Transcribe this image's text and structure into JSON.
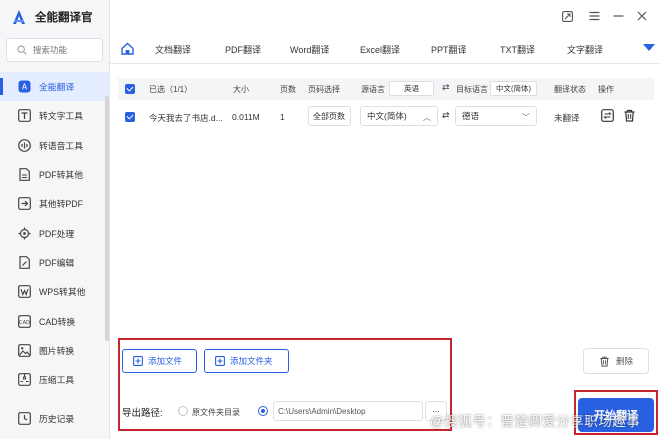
{
  "app": {
    "title": "全能翻译官"
  },
  "search": {
    "placeholder": "搜索功能"
  },
  "sidebar": {
    "items": [
      {
        "label": "全能翻译",
        "icon": "translate-icon",
        "active": true
      },
      {
        "label": "转文字工具",
        "icon": "text-convert-icon"
      },
      {
        "label": "转语音工具",
        "icon": "voice-icon"
      },
      {
        "label": "PDF转其他",
        "icon": "pdf-convert-icon"
      },
      {
        "label": "其他转PDF",
        "icon": "to-pdf-icon"
      },
      {
        "label": "PDF处理",
        "icon": "pdf-process-icon"
      },
      {
        "label": "PDF编辑",
        "icon": "pdf-edit-icon"
      },
      {
        "label": "WPS转其他",
        "icon": "wps-convert-icon"
      },
      {
        "label": "CAD转换",
        "icon": "cad-icon"
      },
      {
        "label": "图片转换",
        "icon": "image-convert-icon"
      },
      {
        "label": "压缩工具",
        "icon": "compress-icon"
      }
    ],
    "history": "历史记录"
  },
  "tabs": [
    {
      "label": "文档翻译",
      "active": true
    },
    {
      "label": "PDF翻译"
    },
    {
      "label": "Word翻译"
    },
    {
      "label": "Excel翻译"
    },
    {
      "label": "PPT翻译"
    },
    {
      "label": "TXT翻译"
    },
    {
      "label": "文字翻译"
    }
  ],
  "table": {
    "headers": {
      "selected": "已选（1/1）",
      "size": "大小",
      "pages": "页数",
      "page_select": "页码选择",
      "source_lang": "源语言",
      "source_lang_value": "英语",
      "target_lang": "目标语言",
      "target_lang_value": "中文(简体)",
      "status": "翻译状态",
      "action": "操作"
    },
    "rows": [
      {
        "name": "今天我去了书店.d...",
        "size": "0.011M",
        "pages": "1",
        "page_select": "全部页数",
        "source": "中文(简体)",
        "target": "德语",
        "status": "未翻译"
      }
    ]
  },
  "buttons": {
    "add_file": "添加文件",
    "add_folder": "添加文件夹",
    "delete": "删除",
    "start": "开始翻译"
  },
  "export": {
    "label": "导出路径:",
    "option_source": "原文件夹目录",
    "path": "C:\\Users\\Admin\\Desktop",
    "browse": "..."
  },
  "watermark": "@搜狐号：晋楚卿爱分享职场趣事",
  "colors": {
    "accent": "#2860e1",
    "highlight": "#c1272d"
  }
}
